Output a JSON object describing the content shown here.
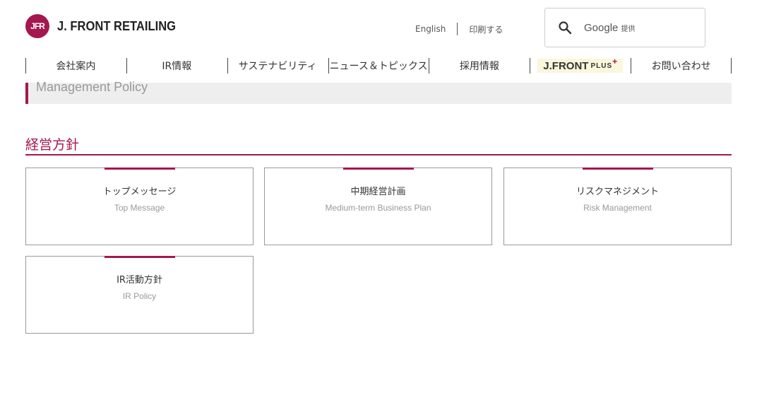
{
  "header": {
    "logo_mark": "JFR",
    "logo_text": "J. FRONT RETAILING",
    "links": [
      "English",
      "印刷する"
    ],
    "search": {
      "brand": "Google",
      "suffix": "提供"
    }
  },
  "nav": {
    "items": [
      "会社案内",
      "IR情報",
      "サステナビリティ",
      "ニュース＆トピックス",
      "採用情報",
      "J.FRONT PLUS+",
      "お問い合わせ"
    ],
    "plus": {
      "main": "J.FRONT",
      "sub": "PLUS",
      "mark": "+"
    }
  },
  "banner": {
    "title": "Management Policy"
  },
  "section": {
    "title": "経営方針"
  },
  "cards": [
    {
      "jp": "トップメッセージ",
      "en": "Top Message"
    },
    {
      "jp": "中期経営計画",
      "en": "Medium-term Business Plan"
    },
    {
      "jp": "リスクマネジメント",
      "en": "Risk Management"
    },
    {
      "jp": "IR活動方針",
      "en": "IR Policy"
    }
  ],
  "colors": {
    "brand": "#a4174f",
    "banner_bg": "#eeeeee"
  }
}
